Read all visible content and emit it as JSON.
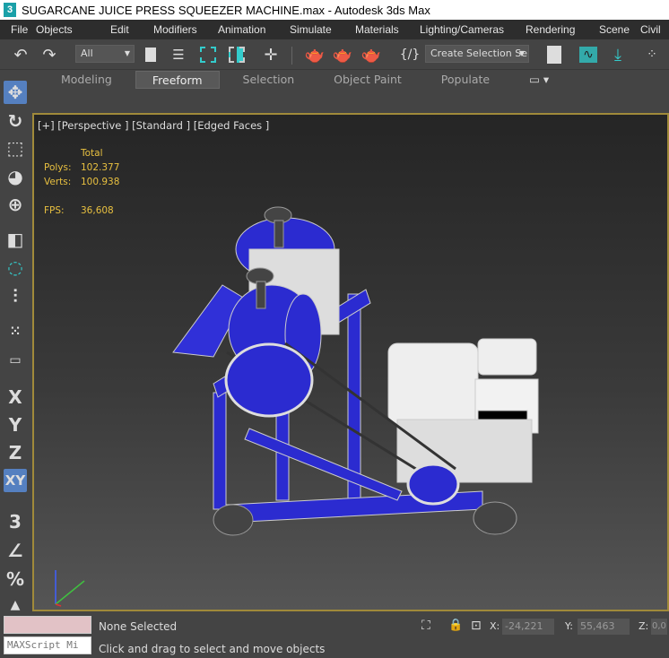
{
  "title": "SUGARCANE JUICE PRESS SQUEEZER MACHINE.max - Autodesk 3ds Max",
  "menu": [
    "File",
    "Objects",
    "Edit",
    "Modifiers",
    "Animation",
    "Simulate",
    "Materials",
    "Lighting/Cameras",
    "Rendering",
    "Scene",
    "Civil"
  ],
  "toolbar": {
    "filter": "All",
    "selection_set": "Create Selection Se"
  },
  "ribbon": {
    "tabs": [
      "Modeling",
      "Freeform",
      "Selection",
      "Object Paint",
      "Populate"
    ],
    "active": "Freeform"
  },
  "left_tools": {
    "x": "X",
    "y": "Y",
    "z": "Z",
    "xy": "XY",
    "snap": "3"
  },
  "viewport": {
    "label": "[+] [Perspective ] [Standard ] [Edged Faces ]",
    "stats": {
      "header": "Total",
      "polys_label": "Polys:",
      "polys": "102.377",
      "verts_label": "Verts:",
      "verts": "100.938",
      "fps_label": "FPS:",
      "fps": "36,608"
    },
    "model_color": "#2b2bd0"
  },
  "status": {
    "maxscript": "MAXScript Mi",
    "selection": "None Selected",
    "prompt": "Click and drag to select and move objects",
    "x_label": "X:",
    "x": "-24,221",
    "y_label": "Y:",
    "y": "55,463",
    "z_label": "Z:",
    "z": "0,0"
  }
}
